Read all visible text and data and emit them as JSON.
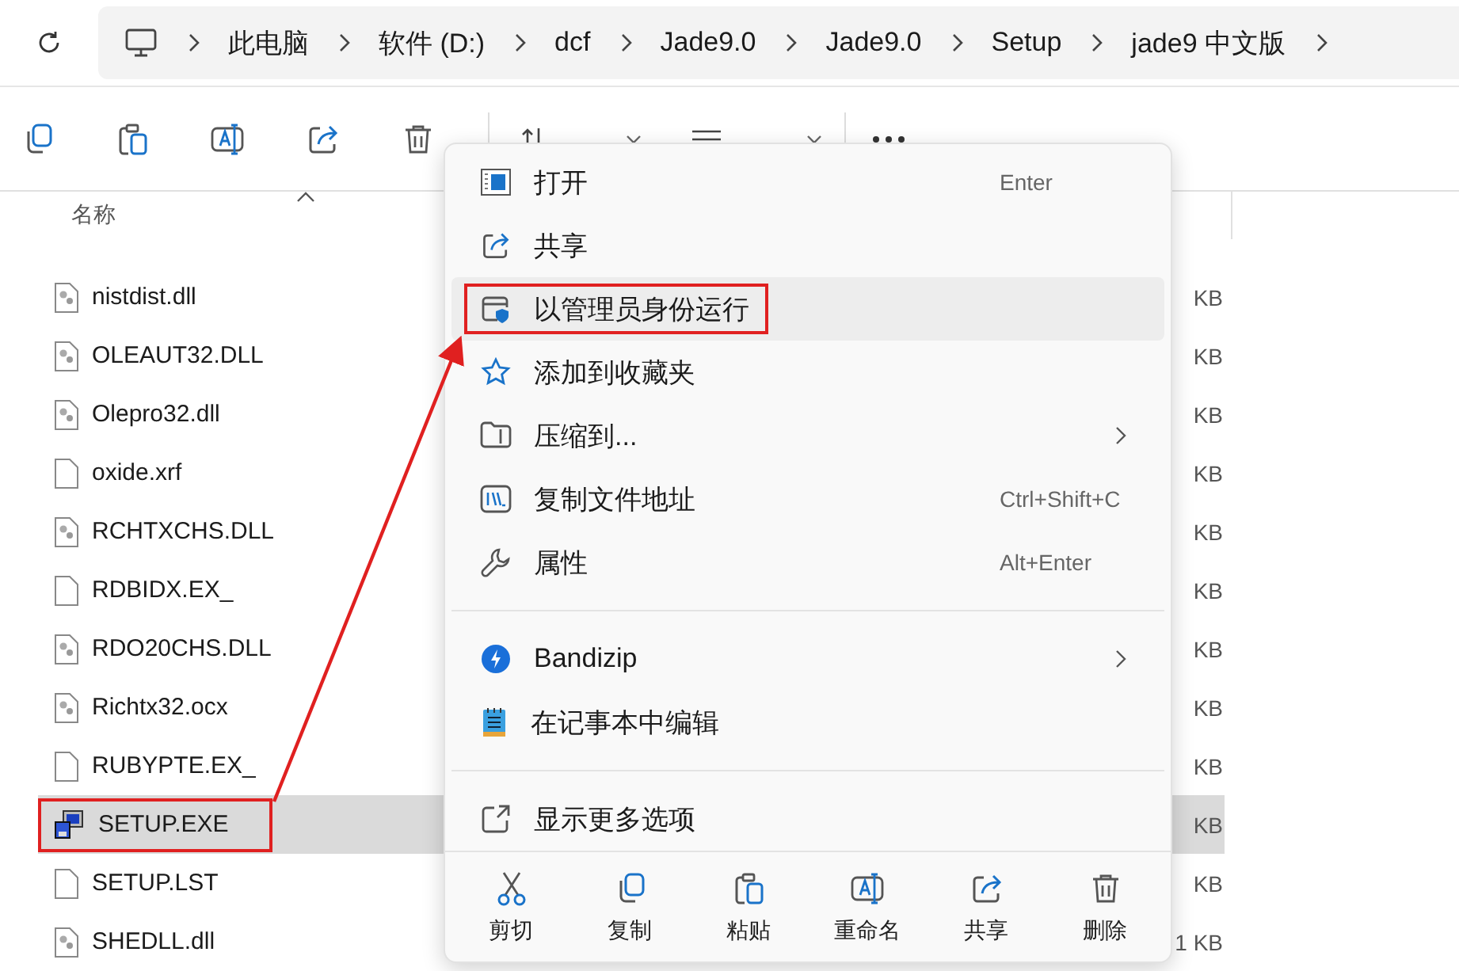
{
  "address_bar": {
    "crumbs": [
      "此电脑",
      "软件 (D:)",
      "dcf",
      "Jade9.0",
      "Jade9.0",
      "Setup",
      "jade9 中文版"
    ]
  },
  "file_list": {
    "column_name": "名称",
    "files": [
      {
        "name": "nistdist.dll",
        "kind": "dll",
        "size": "KB",
        "selected": false,
        "annotated": false
      },
      {
        "name": "OLEAUT32.DLL",
        "kind": "dll",
        "size": "KB",
        "selected": false,
        "annotated": false
      },
      {
        "name": "Olepro32.dll",
        "kind": "dll",
        "size": "KB",
        "selected": false,
        "annotated": false
      },
      {
        "name": "oxide.xrf",
        "kind": "file",
        "size": "KB",
        "selected": false,
        "annotated": false
      },
      {
        "name": "RCHTXCHS.DLL",
        "kind": "dll",
        "size": "KB",
        "selected": false,
        "annotated": false
      },
      {
        "name": "RDBIDX.EX_",
        "kind": "file",
        "size": "KB",
        "selected": false,
        "annotated": false
      },
      {
        "name": "RDO20CHS.DLL",
        "kind": "dll",
        "size": "KB",
        "selected": false,
        "annotated": false
      },
      {
        "name": "Richtx32.ocx",
        "kind": "dll",
        "size": "KB",
        "selected": false,
        "annotated": false
      },
      {
        "name": "RUBYPTE.EX_",
        "kind": "file",
        "size": "KB",
        "selected": false,
        "annotated": false
      },
      {
        "name": "SETUP.EXE",
        "kind": "exe",
        "size": "KB",
        "selected": true,
        "annotated": true
      },
      {
        "name": "SETUP.LST",
        "kind": "file",
        "size": "KB",
        "selected": false,
        "annotated": false
      },
      {
        "name": "SHEDLL.dll",
        "kind": "dll",
        "size": "1 KB",
        "selected": false,
        "annotated": false
      }
    ]
  },
  "context_menu": {
    "items": [
      {
        "kind": "item",
        "label": "打开",
        "shortcut": "Enter",
        "submenu": false,
        "hovered": false,
        "annotated": false
      },
      {
        "kind": "item",
        "label": "共享",
        "submenu": false,
        "hovered": false,
        "annotated": false
      },
      {
        "kind": "item",
        "label": "以管理员身份运行",
        "submenu": false,
        "hovered": true,
        "annotated": true
      },
      {
        "kind": "item",
        "label": "添加到收藏夹",
        "submenu": false,
        "hovered": false,
        "annotated": false
      },
      {
        "kind": "item",
        "label": "压缩到...",
        "submenu": true,
        "hovered": false,
        "annotated": false
      },
      {
        "kind": "item",
        "label": "复制文件地址",
        "shortcut": "Ctrl+Shift+C",
        "submenu": false,
        "hovered": false,
        "annotated": false
      },
      {
        "kind": "item",
        "label": "属性",
        "shortcut": "Alt+Enter",
        "submenu": false,
        "hovered": false,
        "annotated": false
      },
      {
        "kind": "separator"
      },
      {
        "kind": "item",
        "label": "Bandizip",
        "submenu": true,
        "hovered": false,
        "annotated": false
      },
      {
        "kind": "item",
        "label": "在记事本中编辑",
        "submenu": false,
        "hovered": false,
        "annotated": false
      },
      {
        "kind": "separator"
      },
      {
        "kind": "item",
        "label": "显示更多选项",
        "submenu": false,
        "hovered": false,
        "annotated": false
      }
    ],
    "actions": [
      {
        "label": "剪切"
      },
      {
        "label": "复制"
      },
      {
        "label": "粘贴"
      },
      {
        "label": "重命名"
      },
      {
        "label": "共享"
      },
      {
        "label": "删除"
      }
    ]
  }
}
